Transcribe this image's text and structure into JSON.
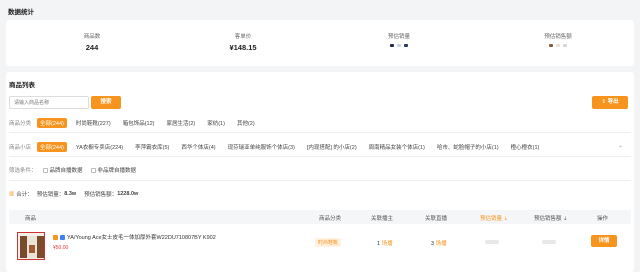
{
  "stats": {
    "title": "数据统计",
    "items": [
      {
        "label": "商品数",
        "value": "244"
      },
      {
        "label": "客单价",
        "value": "¥148.15"
      },
      {
        "label": "预估销量",
        "value": ""
      },
      {
        "label": "预估销售额",
        "value": ""
      }
    ]
  },
  "list": {
    "title": "商品列表",
    "search_placeholder": "请输入商品名称",
    "search_button": "搜索",
    "export_button": "导出",
    "category_filter": {
      "label": "商品分类",
      "options": [
        "全部(244)",
        "时尚鞋靴(227)",
        "箱包饰品(12)",
        "家居生活(2)",
        "家纺(1)",
        "其他(2)"
      ]
    },
    "store_filter": {
      "label": "商品小店",
      "options": [
        "全部(244)",
        "YA衣橱专卖店(224)",
        "李萍霸衣库(5)",
        "西华个体店(4)",
        "现芬瑞亚单纯服饰个体店(3)",
        "[内现搭配] 的小店(2)",
        "周南精品女装个体店(1)",
        "哈市、蛇脸帽子的小店(1)",
        "橙心橙衣(1)"
      ]
    },
    "condition": {
      "label": "筛选条件：",
      "options": [
        "品牌自播数据",
        "非品牌自播数据"
      ]
    },
    "summary": {
      "label": "合计：",
      "sales_label": "预估销量：",
      "sales_value": "8.3w",
      "revenue_label": "预估销售额：",
      "revenue_value": "1228.0w"
    },
    "columns": [
      "商品",
      "商品分类",
      "关联播主",
      "关联直播",
      "预估销量",
      "预估销售额",
      "操作"
    ],
    "rows": [
      {
        "name": "YA/Young Ace女士皮毛一体加厚外套W22DU710807BY K902",
        "price": "¥50.00",
        "category": "时尚鞋靴",
        "anchors": "1",
        "anchors_unit": "场播",
        "lives": "3",
        "lives_unit": "场播",
        "action": "详情"
      }
    ]
  },
  "colors": {
    "accent": "#f7941d",
    "background": "#f3f4f6"
  }
}
